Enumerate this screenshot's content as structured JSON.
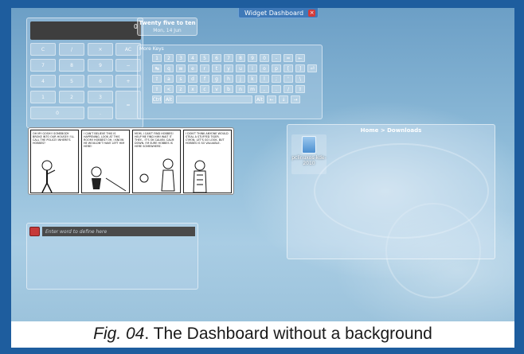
{
  "dashboard": {
    "tab_label": "Widget Dashboard"
  },
  "calculator": {
    "display": "0",
    "keys": [
      "C",
      "/",
      "×",
      "AC",
      "7",
      "8",
      "9",
      "−",
      "4",
      "5",
      "6",
      "+",
      "1",
      "2",
      "3",
      "=",
      "0",
      "."
    ]
  },
  "clock": {
    "time_text": "Twenty five to ten",
    "date_text": "Mon, 14 Jun"
  },
  "keyboard": {
    "title": "More Keys",
    "rows": [
      [
        "1",
        "2",
        "3",
        "4",
        "5",
        "6",
        "7",
        "8",
        "9",
        "0",
        "-",
        "=",
        "←"
      ],
      [
        "↹",
        "q",
        "w",
        "e",
        "r",
        "t",
        "y",
        "u",
        "i",
        "o",
        "p",
        "[",
        "]",
        "⏎"
      ],
      [
        "⇪",
        "a",
        "s",
        "d",
        "f",
        "g",
        "h",
        "j",
        "k",
        "l",
        ";",
        "'",
        "\\"
      ],
      [
        "⇧",
        "<",
        "z",
        "x",
        "c",
        "v",
        "b",
        "n",
        "m",
        ",",
        ".",
        "/",
        "⇧"
      ],
      [
        "Ctrl",
        "Alt",
        "",
        "Alt",
        "←",
        "↓",
        "→"
      ]
    ]
  },
  "comic": {
    "panels": [
      "OH MY GOSH!! SOMEBODY BROKE INTO OUR HOUSE!! I'LL CALL THE POLICE! WHERE'S HOBBES?",
      "I CAN'T BELIEVE THIS IS HAPPENING. LOOK AT THIS ROOM! HOBBES? OH, I KNOW HE WOULDN'T HAVE LEFT HIM HERE!",
      "MOM, I CAN'T FIND HOBBES! HELP ME FIND HIM! WAIT IT THEY... IT'S OK CALVIN. CALM DOWN. I'M SURE HOBBES IS HERE SOMEWHERE.",
      "I DON'T THINK ANYONE WOULD STEAL A STUFFED TIGER. C'MON, LET'S GO LOOK. BUT HOBBES IS SO VALUABLE."
    ]
  },
  "folder_view": {
    "title": "Home > Downloads",
    "items": [
      {
        "name": "pclinuxos-kde-2010",
        "icon": "file-icon"
      }
    ]
  },
  "dictionary": {
    "placeholder": "Enter word to define here"
  },
  "caption": {
    "fig": "Fig. 04",
    "text": ". The Dashboard without a background"
  },
  "colors": {
    "frame": "#1e5d9e",
    "tab": "#3f79b8",
    "close": "#d23b3b",
    "dict_icon": "#c63a3a"
  }
}
